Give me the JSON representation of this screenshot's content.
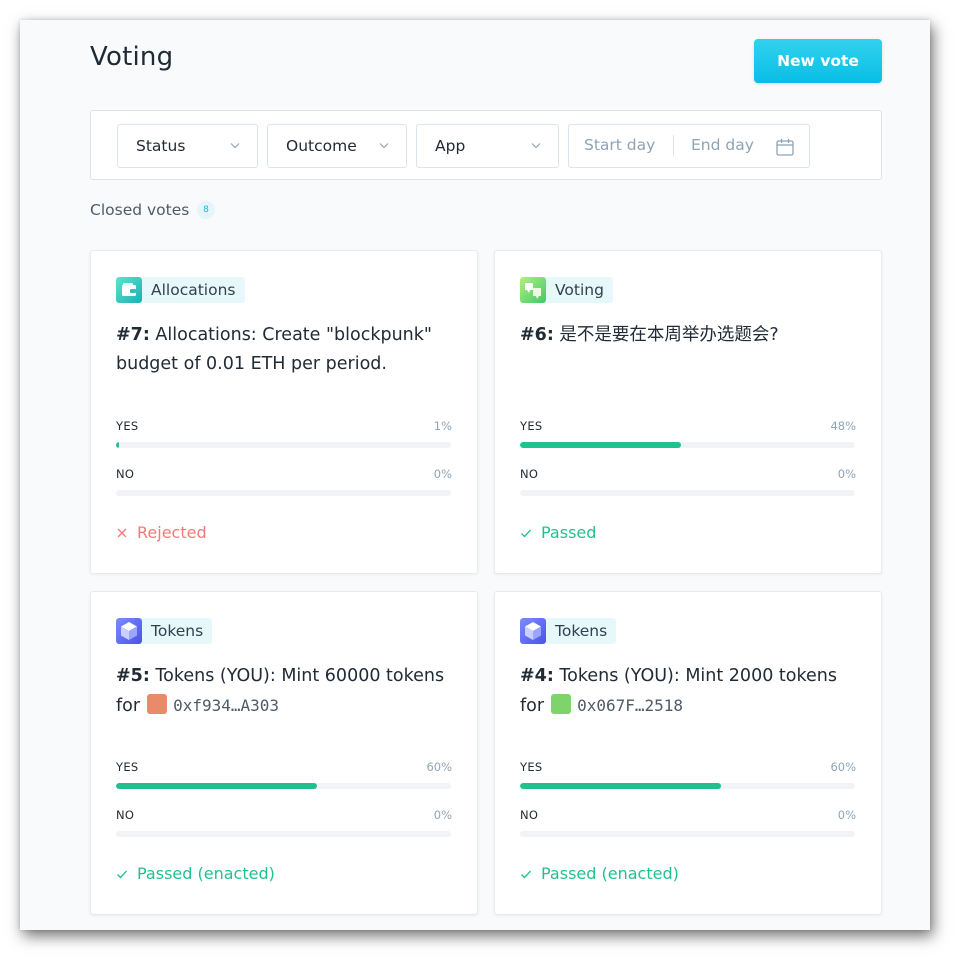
{
  "header": {
    "title": "Voting",
    "new_vote_label": "New vote"
  },
  "filters": {
    "status_label": "Status",
    "outcome_label": "Outcome",
    "app_label": "App",
    "start_placeholder": "Start day",
    "end_placeholder": "End day"
  },
  "section": {
    "label": "Closed votes",
    "count": "8"
  },
  "colors": {
    "accent": "#08bee5",
    "passed": "#21c18f",
    "rejected": "#fb7777",
    "bar_track": "#f1f3f6"
  },
  "votes": [
    {
      "app": "Allocations",
      "app_icon": "wallet-icon",
      "number": "#7:",
      "title": "Allocations: Create \"blockpunk\" budget of 0.01 ETH per period.",
      "yes_label": "YES",
      "yes_pct": "1%",
      "yes_value": 0.01,
      "no_label": "NO",
      "no_pct": "0%",
      "no_value": 0,
      "status": "Rejected",
      "status_icon": "close-icon"
    },
    {
      "app": "Voting",
      "app_icon": "voting-hand-icon",
      "number": "#6:",
      "title": "是不是要在本周举办选题会?",
      "yes_label": "YES",
      "yes_pct": "48%",
      "yes_value": 0.48,
      "no_label": "NO",
      "no_pct": "0%",
      "no_value": 0,
      "status": "Passed",
      "status_icon": "check-icon"
    },
    {
      "app": "Tokens",
      "app_icon": "cube-icon",
      "number": "#5:",
      "title": "Tokens (YOU): Mint 60000 tokens for",
      "address": "0xf934…A303",
      "yes_label": "YES",
      "yes_pct": "60%",
      "yes_value": 0.6,
      "no_label": "NO",
      "no_pct": "0%",
      "no_value": 0,
      "status": "Passed (enacted)",
      "status_icon": "check-icon"
    },
    {
      "app": "Tokens",
      "app_icon": "cube-icon",
      "number": "#4:",
      "title": "Tokens (YOU): Mint 2000 tokens for",
      "address": "0x067F…2518",
      "yes_label": "YES",
      "yes_pct": "60%",
      "yes_value": 0.6,
      "no_label": "NO",
      "no_pct": "0%",
      "no_value": 0,
      "status": "Passed (enacted)",
      "status_icon": "check-icon"
    }
  ]
}
